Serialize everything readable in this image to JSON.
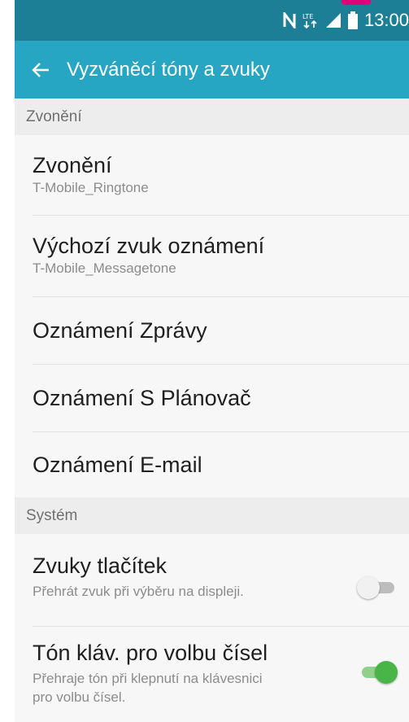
{
  "status_bar": {
    "time": "13:00",
    "icons": [
      "nfc-icon",
      "lte-icon",
      "signal-icon",
      "battery-icon"
    ]
  },
  "app_bar": {
    "title": "Vyzváněcí tóny a zvuky",
    "back_icon": "arrow-back-icon"
  },
  "sections": [
    {
      "header": "Zvonění",
      "items": [
        {
          "title": "Zvonění",
          "subtitle": "T-Mobile_Ringtone"
        },
        {
          "title": "Výchozí zvuk oznámení",
          "subtitle": "T-Mobile_Messagetone"
        },
        {
          "title": "Oznámení Zprávy"
        },
        {
          "title": "Oznámení S Plánovač"
        },
        {
          "title": "Oznámení E-mail"
        }
      ]
    },
    {
      "header": "Systém",
      "items": [
        {
          "title": "Zvuky tlačítek",
          "subtitle": "Přehrát zvuk při výběru na displeji.",
          "toggle": false
        },
        {
          "title": "Tón kláv. pro volbu čísel",
          "subtitle_lines": [
            "Přehraje tón při klepnutí na klávesnici",
            "pro volbu čísel."
          ],
          "toggle": true
        }
      ]
    }
  ],
  "colors": {
    "app_bar": "#26a6c2",
    "status_bar": "#1c7f95",
    "toggle_on": "#49b548",
    "accent_notch": "#e2007a"
  }
}
